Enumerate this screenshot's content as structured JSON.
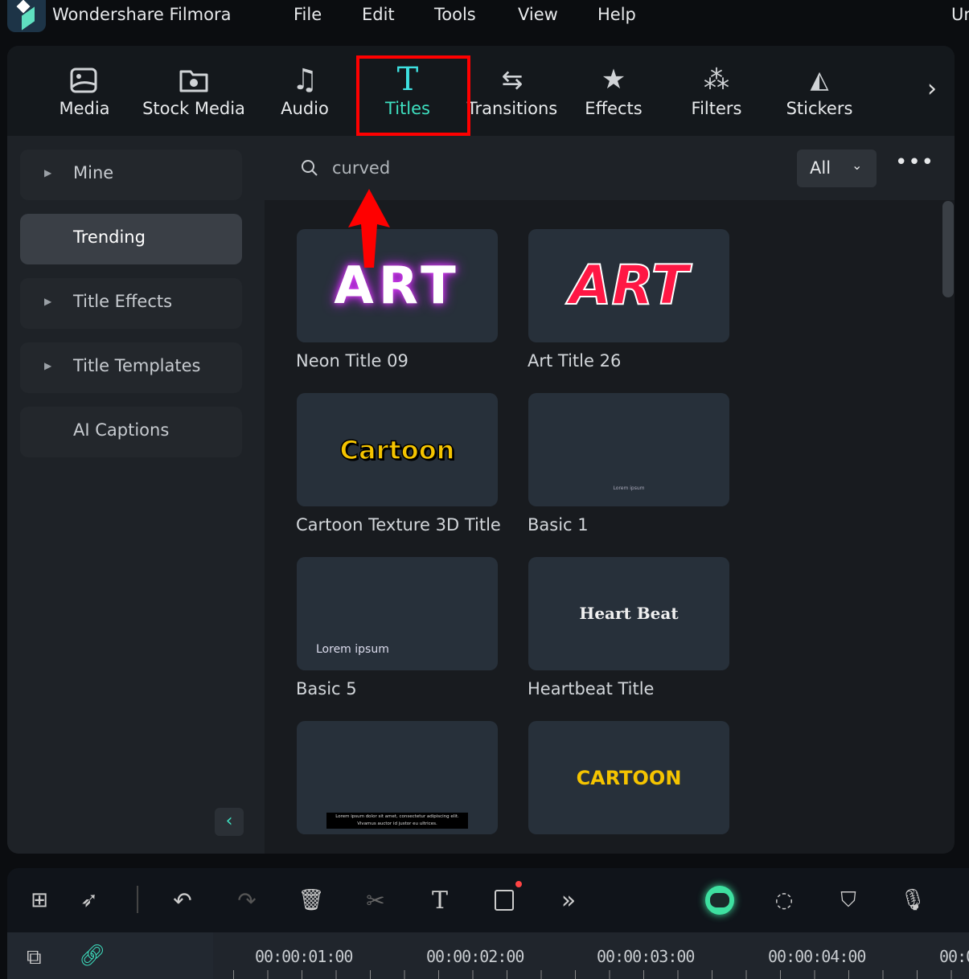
{
  "app": {
    "title": "Wondershare Filmora",
    "menu": [
      "File",
      "Edit",
      "Tools",
      "View",
      "Help",
      "Ur"
    ]
  },
  "tabs": [
    {
      "label": "Media",
      "icon": "media-icon"
    },
    {
      "label": "Stock Media",
      "icon": "cloud-folder-icon"
    },
    {
      "label": "Audio",
      "icon": "music-note-icon"
    },
    {
      "label": "Titles",
      "icon": "text-t-icon",
      "active": true
    },
    {
      "label": "Transitions",
      "icon": "transitions-icon"
    },
    {
      "label": "Effects",
      "icon": "magic-star-icon"
    },
    {
      "label": "Filters",
      "icon": "filters-icon"
    },
    {
      "label": "Stickers",
      "icon": "stickers-icon"
    }
  ],
  "sidebar": {
    "items": [
      {
        "label": "Mine",
        "expandable": true
      },
      {
        "label": "Trending",
        "active": true
      },
      {
        "label": "Title Effects",
        "expandable": true
      },
      {
        "label": "Title Templates",
        "expandable": true
      },
      {
        "label": "AI Captions"
      }
    ]
  },
  "search": {
    "value": "curved",
    "filter": "All"
  },
  "grid": {
    "items": [
      {
        "name": "Neon Title 09",
        "preview": "ART"
      },
      {
        "name": "Art Title 26",
        "preview": "ART"
      },
      {
        "name": "Cartoon Texture 3D Title",
        "preview": "Cartoon"
      },
      {
        "name": "Basic 1",
        "preview": "Lorem ipsum"
      },
      {
        "name": "Basic 5",
        "preview": "Lorem ipsum"
      },
      {
        "name": "Heartbeat Title",
        "preview": "Heart Beat"
      },
      {
        "name": "",
        "preview": "Lorem ipsum dolor sit amet, consectetur adipiscing elit. Vivamus auctor id justor eu ultrices."
      },
      {
        "name": "",
        "preview": "CARTOON"
      }
    ]
  },
  "timeline": {
    "ticks": [
      "00:00:01:00",
      "00:00:02:00",
      "00:00:03:00",
      "00:00:04:00",
      "00:0"
    ]
  },
  "colors": {
    "accent": "#3ee0c0",
    "highlight": "#ff0000",
    "neon": "#e040fb",
    "art_red": "#ff1744",
    "cartoon_yellow": "#f5c400"
  }
}
